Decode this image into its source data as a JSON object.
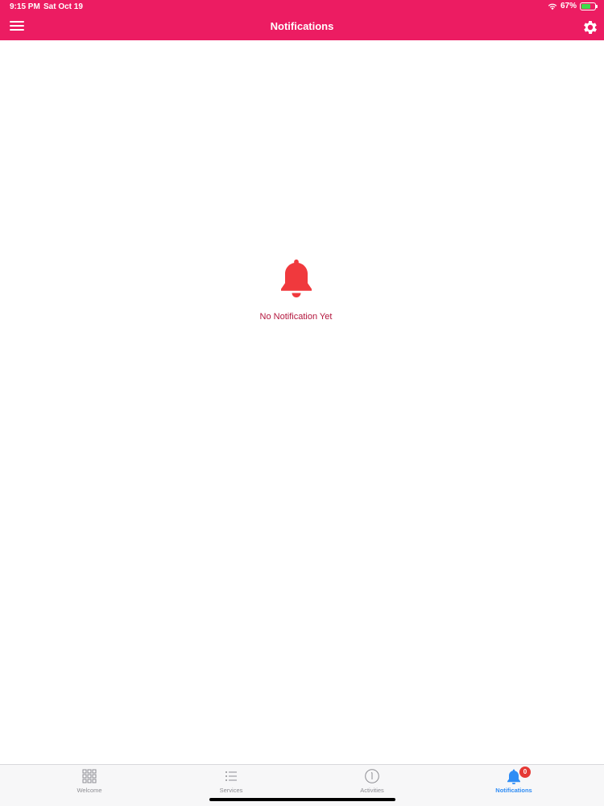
{
  "status_bar": {
    "time": "9:15 PM",
    "date": "Sat Oct 19",
    "battery_percent": "67%",
    "battery_level": 0.67
  },
  "nav": {
    "title": "Notifications",
    "menu_icon": "hamburger-menu-icon",
    "settings_icon": "gear-icon"
  },
  "empty_state": {
    "icon": "bell-icon",
    "message": "No Notification Yet"
  },
  "tabs": [
    {
      "label": "Welcome",
      "icon": "grid-icon",
      "active": false
    },
    {
      "label": "Services",
      "icon": "list-icon",
      "active": false
    },
    {
      "label": "Activities",
      "icon": "clock-icon",
      "active": false
    },
    {
      "label": "Notifications",
      "icon": "bell-icon",
      "active": true,
      "badge": "0"
    }
  ],
  "colors": {
    "header": "#ec1c62",
    "bell": "#f0393d",
    "empty_text": "#b3163d",
    "tab_active": "#2f8df5",
    "tab_inactive": "#8e8e93",
    "badge": "#e53935"
  }
}
